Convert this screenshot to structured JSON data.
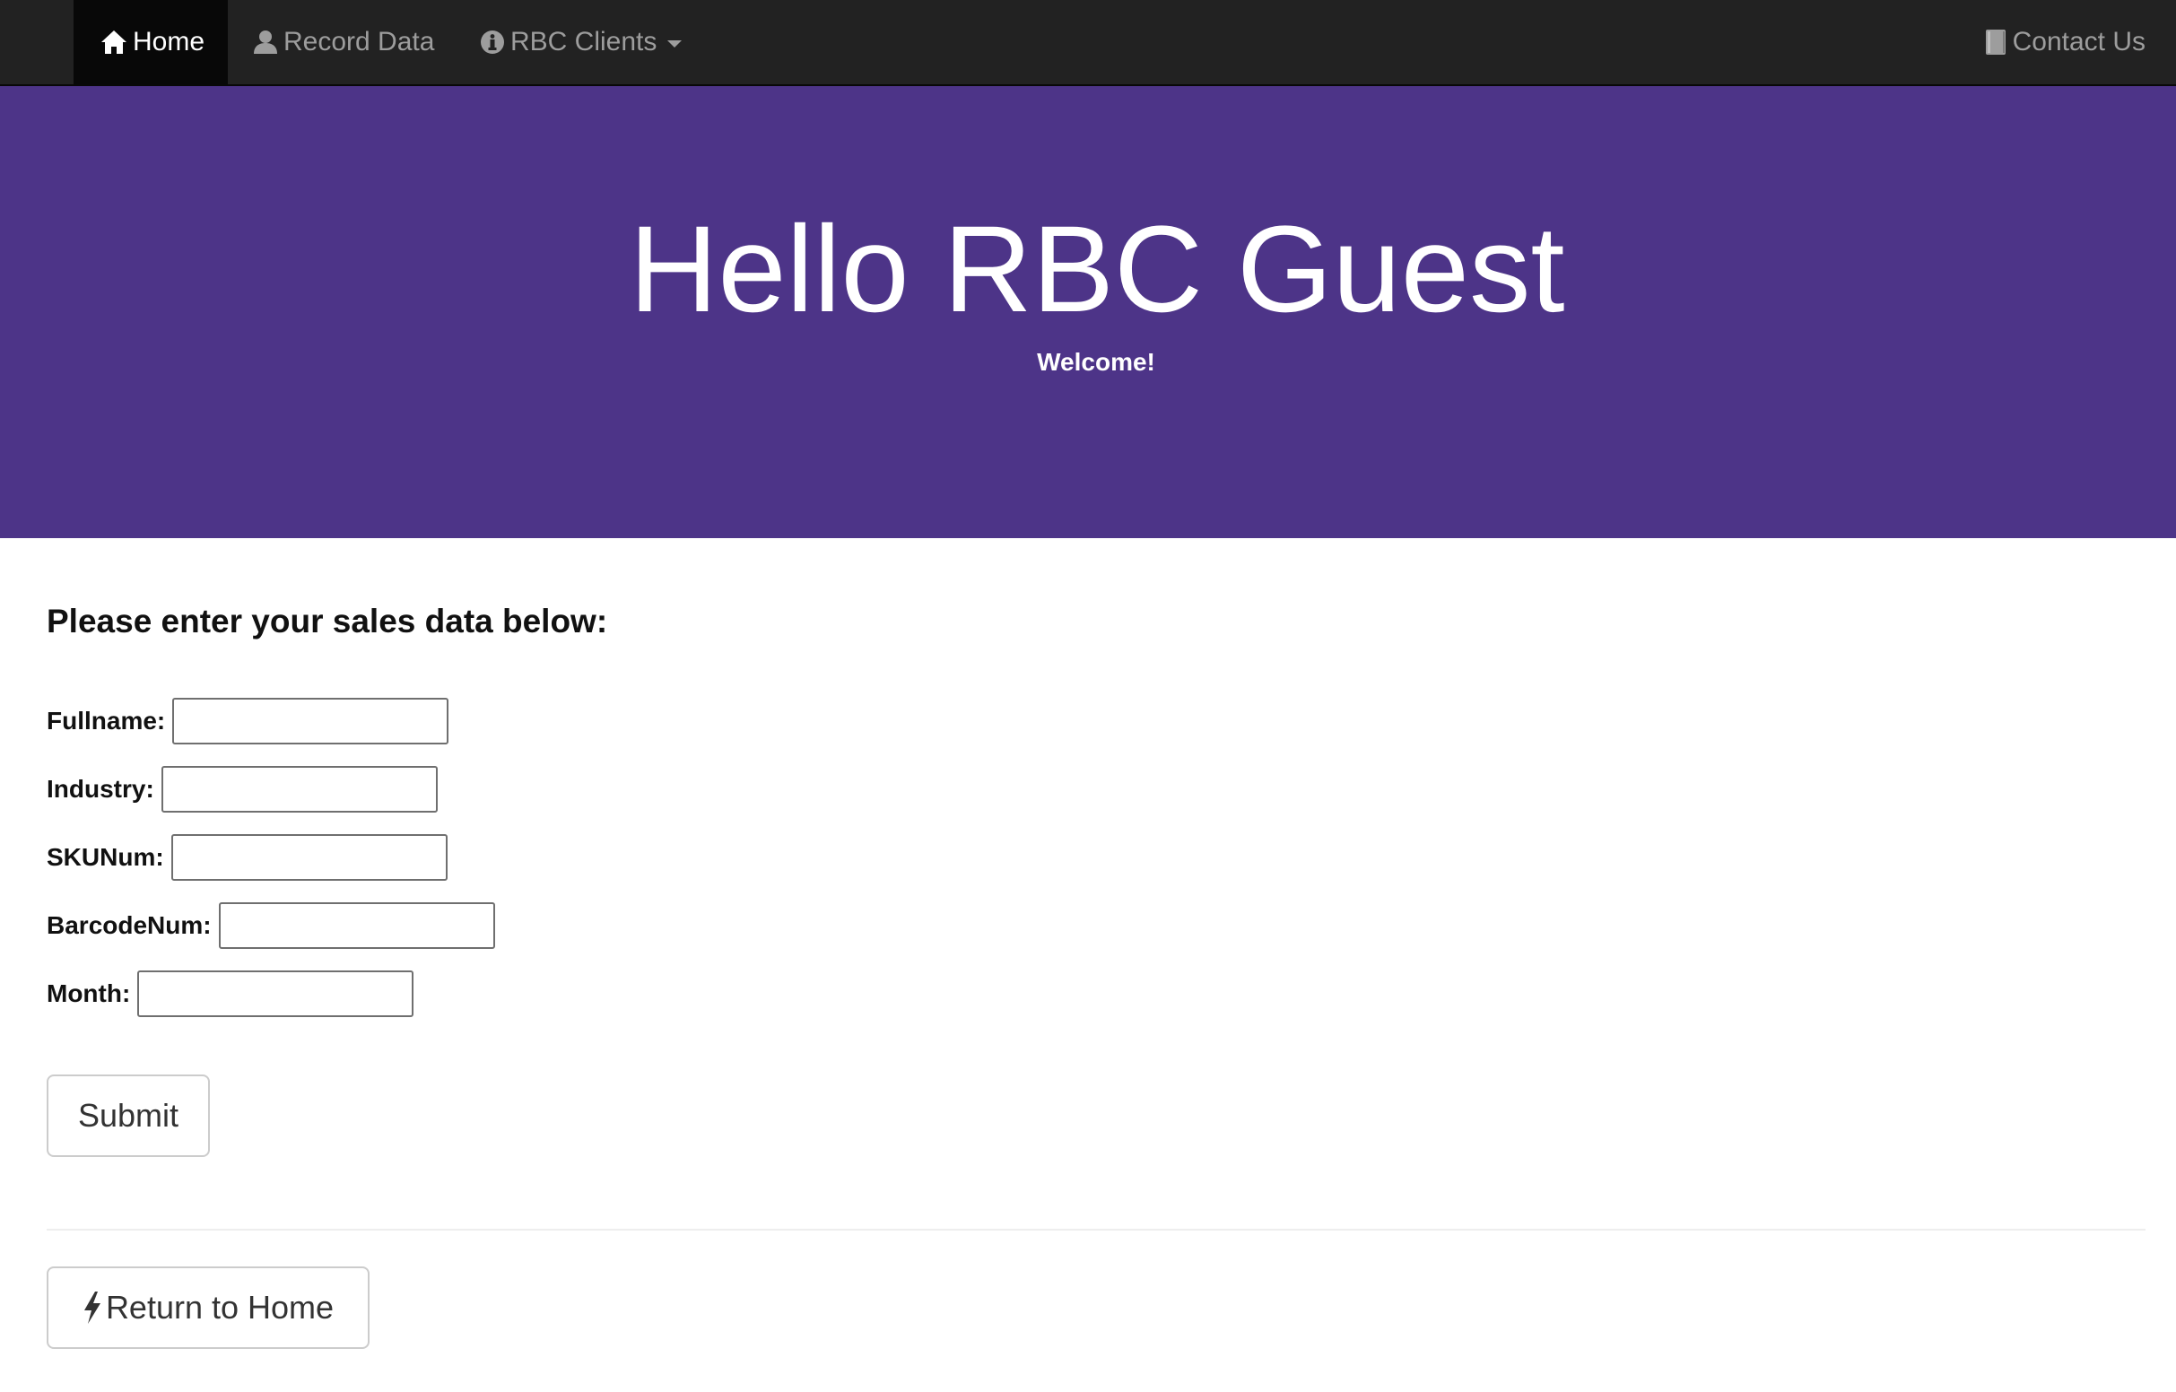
{
  "navbar": {
    "home_label": "Home",
    "record_label": "Record Data",
    "clients_label": "RBC Clients",
    "contact_label": "Contact Us"
  },
  "hero": {
    "title": "Hello RBC Guest",
    "subtitle": "Welcome!"
  },
  "form": {
    "heading": "Please enter your sales data below:",
    "fields": [
      {
        "label": "Fullname:",
        "value": ""
      },
      {
        "label": "Industry:",
        "value": ""
      },
      {
        "label": "SKUNum:",
        "value": ""
      },
      {
        "label": "BarcodeNum:",
        "value": ""
      },
      {
        "label": "Month:",
        "value": ""
      }
    ],
    "submit_label": "Submit"
  },
  "footer": {
    "return_label": "Return to Home"
  },
  "colors": {
    "navbar_bg": "#222222",
    "navbar_active_bg": "#080808",
    "jumbotron_bg": "#4d3488"
  },
  "icons": {
    "home": "home-icon",
    "record": "user-icon",
    "clients": "info-icon",
    "contact": "book-icon",
    "return": "flash-icon"
  }
}
